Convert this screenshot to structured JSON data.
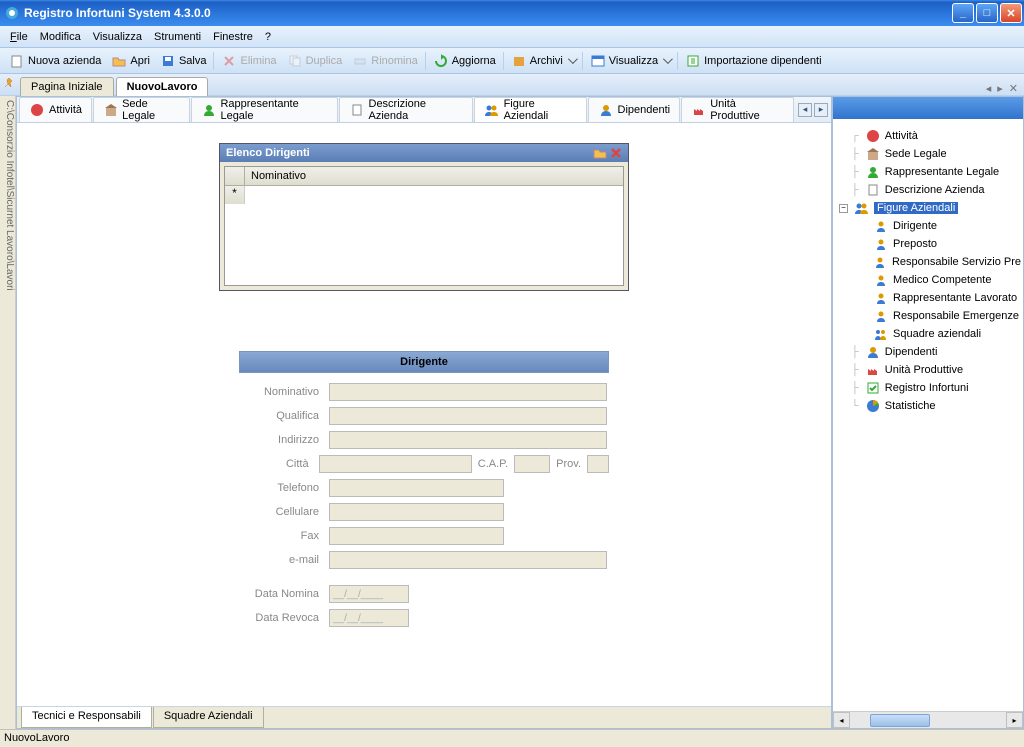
{
  "window": {
    "title": "Registro Infortuni System  4.3.0.0"
  },
  "menu": {
    "file": "File",
    "modifica": "Modifica",
    "visualizza": "Visualizza",
    "strumenti": "Strumenti",
    "finestre": "Finestre",
    "help": "?"
  },
  "toolbar": {
    "nuova_azienda": "Nuova azienda",
    "apri": "Apri",
    "salva": "Salva",
    "elimina": "Elimina",
    "duplica": "Duplica",
    "rinomina": "Rinomina",
    "aggiorna": "Aggiorna",
    "archivi": "Archivi",
    "visualizza": "Visualizza",
    "importazione": "Importazione dipendenti"
  },
  "doctabs": {
    "pagina_iniziale": "Pagina Iniziale",
    "nuovo_lavoro": "NuovoLavoro"
  },
  "leftvert": "C:\\Consorzio Infotel\\Sicurnet Lavoro\\Lavori",
  "content_tabs": {
    "attivita": "Attività",
    "sede_legale": "Sede Legale",
    "rappresentante": "Rappresentante Legale",
    "descrizione": "Descrizione Azienda",
    "figure": "Figure Aziendali",
    "dipendenti": "Dipendenti",
    "unita": "Unità Produttive"
  },
  "inner_window": {
    "title": "Elenco Dirigenti",
    "col_nominativo": "Nominativo"
  },
  "form": {
    "title": "Dirigente",
    "nominativo": "Nominativo",
    "qualifica": "Qualifica",
    "indirizzo": "Indirizzo",
    "citta": "Città",
    "cap": "C.A.P.",
    "prov": "Prov.",
    "telefono": "Telefono",
    "cellulare": "Cellulare",
    "fax": "Fax",
    "email": "e-mail",
    "data_nomina": "Data Nomina",
    "data_revoca": "Data Revoca",
    "date_placeholder": "__/__/____"
  },
  "bottom_tabs": {
    "tecnici": "Tecnici e Responsabili",
    "squadre": "Squadre Aziendali"
  },
  "tree": {
    "attivita": "Attività",
    "sede_legale": "Sede Legale",
    "rappresentante": "Rappresentante Legale",
    "descrizione": "Descrizione Azienda",
    "figure": "Figure Aziendali",
    "dirigente": "Dirigente",
    "preposto": "Preposto",
    "resp_servizio": "Responsabile Servizio Pre",
    "medico": "Medico Competente",
    "rapp_lavoratori": "Rappresentante Lavorato",
    "resp_emergenze": "Responsabile Emergenze",
    "squadre": "Squadre aziendali",
    "dipendenti": "Dipendenti",
    "unita": "Unità Produttive",
    "registro": "Registro Infortuni",
    "statistiche": "Statistiche"
  },
  "status": "NuovoLavoro"
}
